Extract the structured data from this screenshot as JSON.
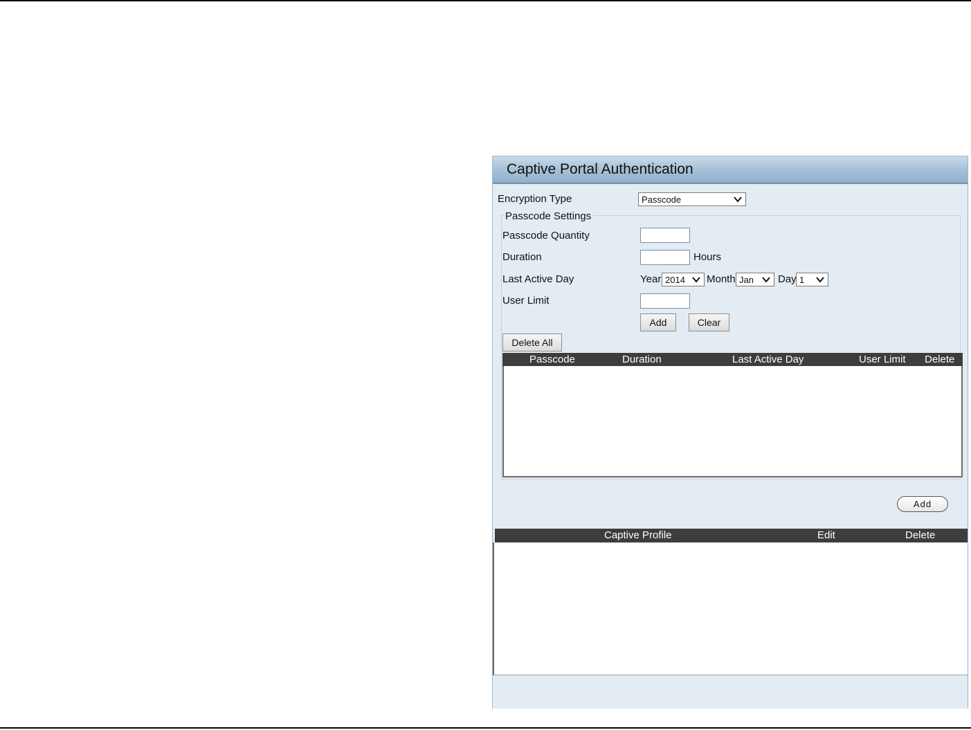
{
  "panel": {
    "title": "Captive Portal Authentication"
  },
  "form": {
    "encryption_type_label": "Encryption Type",
    "encryption_type_value": "Passcode",
    "passcode_settings_legend": "Passcode Settings",
    "passcode_quantity_label": "Passcode Quantity",
    "passcode_quantity_value": "",
    "duration_label": "Duration",
    "duration_value": "",
    "duration_unit": "Hours",
    "last_active_day_label": "Last Active Day",
    "year_label": "Year",
    "year_value": "2014",
    "month_label": "Month",
    "month_value": "Jan",
    "day_label": "Day",
    "day_value": "1",
    "user_limit_label": "User Limit",
    "user_limit_value": "",
    "add_button": "Add",
    "clear_button": "Clear",
    "delete_all_button": "Delete All"
  },
  "passcode_table": {
    "columns": [
      "Passcode",
      "Duration",
      "Last Active Day",
      "User Limit",
      "Delete"
    ],
    "rows": []
  },
  "profile_add_button": "Add",
  "profile_table": {
    "columns": [
      "Captive Profile",
      "Edit",
      "Delete"
    ],
    "rows": []
  },
  "icons": {
    "dropdown": "chevron-down-icon"
  },
  "colors": {
    "header_gradient_start": "#c9dbea",
    "header_gradient_end": "#8fb0cb",
    "panel_bg": "#e4ecf3",
    "table_header_bg": "#3d3d3d"
  }
}
